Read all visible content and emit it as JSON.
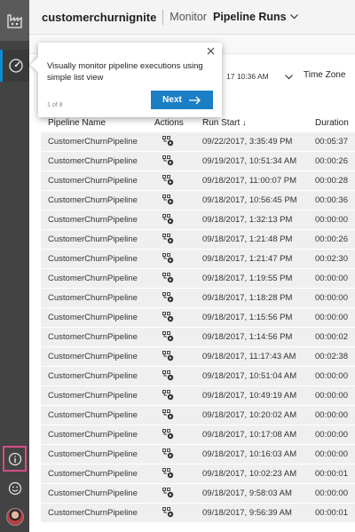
{
  "app": {
    "name": "customerchurnignite",
    "breadcrumb_section": "Monitor",
    "breadcrumb_current": "Pipeline Runs"
  },
  "colors": {
    "sidebar_bg": "#434343",
    "accent": "#1a7fc4",
    "highlight_border": "#d54d89",
    "row_bg": "#efefef"
  },
  "icons": {
    "factory": "factory-icon",
    "monitor": "gauge-icon",
    "info": "info-icon",
    "feedback": "smiley-icon",
    "action": "run-actions-icon",
    "close": "close-icon",
    "next": "arrow-right-icon"
  },
  "filters": {
    "date_value": "17 10:36 AM",
    "timezone_label": "Time Zone"
  },
  "tooltip": {
    "text": "Visually monitor pipeline executions using simple list view",
    "step": "1 of 8",
    "next_label": "Next"
  },
  "table": {
    "headers": [
      "Pipeline Name",
      "Actions",
      "Run Start",
      "Duration"
    ],
    "sort_indicator": "↓",
    "rows": [
      {
        "name": "CustomerChurnPipeline",
        "start": "09/22/2017, 3:35:49 PM",
        "duration": "00:05:37"
      },
      {
        "name": "CustomerChurnPipeline",
        "start": "09/19/2017, 10:51:34 AM",
        "duration": "00:00:26"
      },
      {
        "name": "CustomerChurnPipeline",
        "start": "09/18/2017, 11:00:07 PM",
        "duration": "00:00:28"
      },
      {
        "name": "CustomerChurnPipeline",
        "start": "09/18/2017, 10:56:45 PM",
        "duration": "00:00:36"
      },
      {
        "name": "CustomerChurnPipeline",
        "start": "09/18/2017, 1:32:13 PM",
        "duration": "00:00:00"
      },
      {
        "name": "CustomerChurnPipeline",
        "start": "09/18/2017, 1:21:48 PM",
        "duration": "00:00:26"
      },
      {
        "name": "CustomerChurnPipeline",
        "start": "09/18/2017, 1:21:47 PM",
        "duration": "00:02:30"
      },
      {
        "name": "CustomerChurnPipeline",
        "start": "09/18/2017, 1:19:55 PM",
        "duration": "00:00:00"
      },
      {
        "name": "CustomerChurnPipeline",
        "start": "09/18/2017, 1:18:28 PM",
        "duration": "00:00:00"
      },
      {
        "name": "CustomerChurnPipeline",
        "start": "09/18/2017, 1:15:56 PM",
        "duration": "00:00:00"
      },
      {
        "name": "CustomerChurnPipeline",
        "start": "09/18/2017, 1:14:56 PM",
        "duration": "00:00:02"
      },
      {
        "name": "CustomerChurnPipeline",
        "start": "09/18/2017, 11:17:43 AM",
        "duration": "00:02:38"
      },
      {
        "name": "CustomerChurnPipeline",
        "start": "09/18/2017, 10:51:04 AM",
        "duration": "00:00:00"
      },
      {
        "name": "CustomerChurnPipeline",
        "start": "09/18/2017, 10:49:19 AM",
        "duration": "00:00:00"
      },
      {
        "name": "CustomerChurnPipeline",
        "start": "09/18/2017, 10:20:02 AM",
        "duration": "00:00:00"
      },
      {
        "name": "CustomerChurnPipeline",
        "start": "09/18/2017, 10:17:08 AM",
        "duration": "00:00:00"
      },
      {
        "name": "CustomerChurnPipeline",
        "start": "09/18/2017, 10:16:03 AM",
        "duration": "00:00:00"
      },
      {
        "name": "CustomerChurnPipeline",
        "start": "09/18/2017, 10:02:23 AM",
        "duration": "00:00:01"
      },
      {
        "name": "CustomerChurnPipeline",
        "start": "09/18/2017, 9:58:03 AM",
        "duration": "00:00:00"
      },
      {
        "name": "CustomerChurnPipeline",
        "start": "09/18/2017, 9:56:39 AM",
        "duration": "00:00:01"
      }
    ]
  }
}
